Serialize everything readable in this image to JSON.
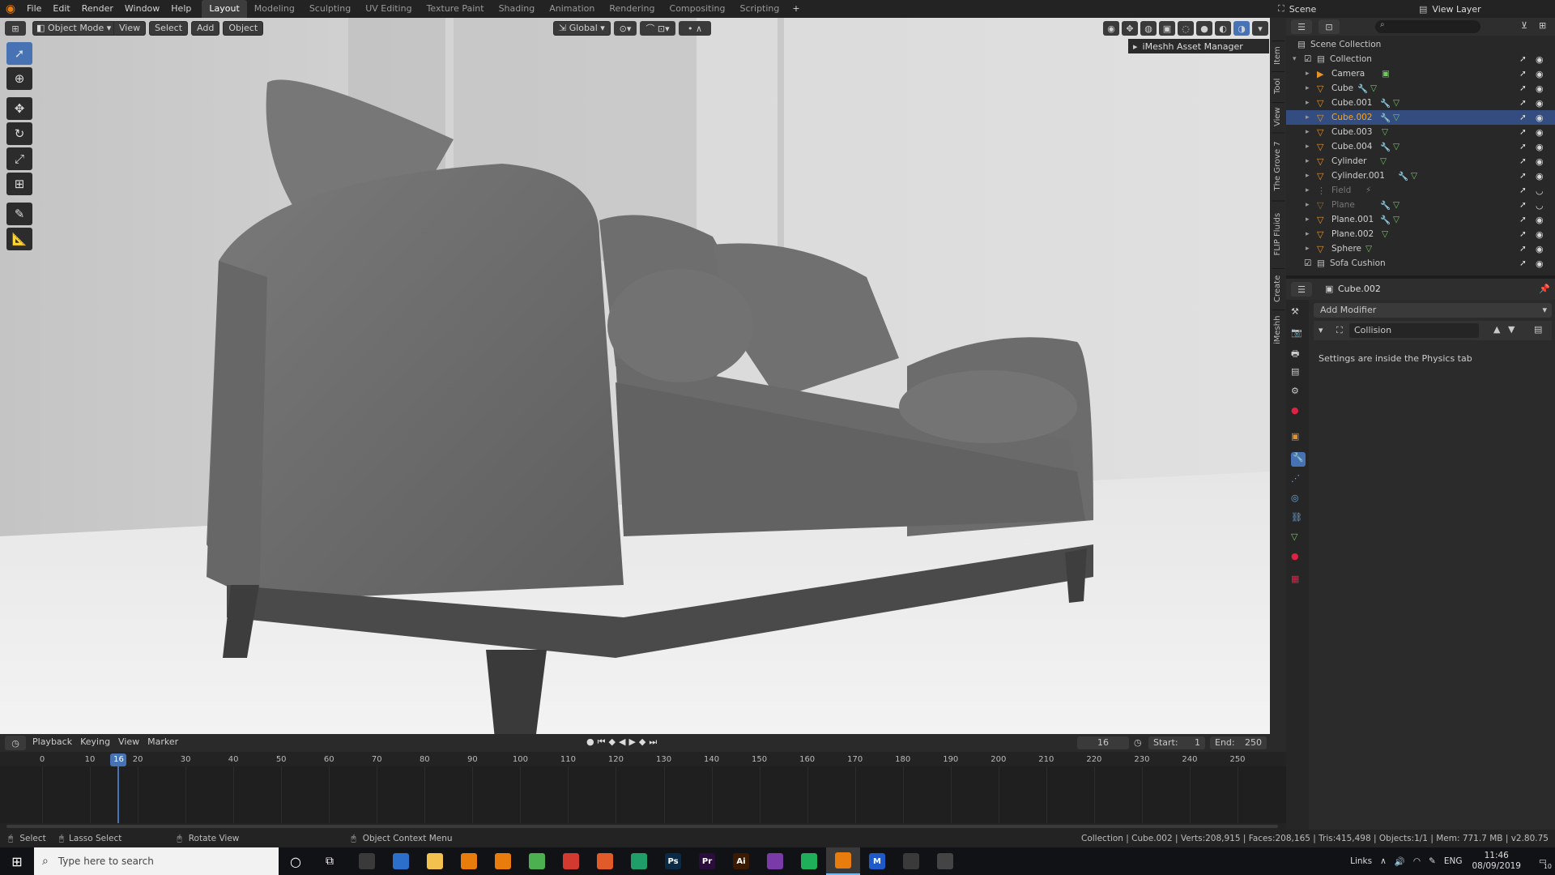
{
  "topbar": {
    "menus": [
      "File",
      "Edit",
      "Render",
      "Window",
      "Help"
    ],
    "workspaces": [
      "Layout",
      "Modeling",
      "Sculpting",
      "UV Editing",
      "Texture Paint",
      "Shading",
      "Animation",
      "Rendering",
      "Compositing",
      "Scripting"
    ],
    "active_workspace": "Layout",
    "scene_label": "Scene",
    "view_layer_label": "View Layer"
  },
  "viewport_header": {
    "mode": "Object Mode",
    "menus": [
      "View",
      "Select",
      "Add",
      "Object"
    ],
    "transform_orientation": "Global",
    "addon_panel": "iMeshh Asset Manager",
    "side_tabs": [
      "Item",
      "Tool",
      "View",
      "The Grove 7",
      "FLIP Fluids",
      "Create",
      "iMeshh"
    ]
  },
  "outliner": {
    "root": "Scene Collection",
    "collection": "Collection",
    "items": [
      {
        "name": "Camera",
        "type": "camera",
        "dimmed": false,
        "selected": false
      },
      {
        "name": "Cube",
        "type": "mesh",
        "dimmed": false,
        "selected": false
      },
      {
        "name": "Cube.001",
        "type": "mesh",
        "dimmed": false,
        "selected": false
      },
      {
        "name": "Cube.002",
        "type": "mesh",
        "dimmed": false,
        "selected": true
      },
      {
        "name": "Cube.003",
        "type": "mesh",
        "dimmed": false,
        "selected": false
      },
      {
        "name": "Cube.004",
        "type": "mesh",
        "dimmed": false,
        "selected": false
      },
      {
        "name": "Cylinder",
        "type": "mesh",
        "dimmed": false,
        "selected": false
      },
      {
        "name": "Cylinder.001",
        "type": "mesh",
        "dimmed": false,
        "selected": false
      },
      {
        "name": "Field",
        "type": "field",
        "dimmed": true,
        "selected": false
      },
      {
        "name": "Plane",
        "type": "mesh",
        "dimmed": true,
        "selected": false
      },
      {
        "name": "Plane.001",
        "type": "mesh",
        "dimmed": false,
        "selected": false
      },
      {
        "name": "Plane.002",
        "type": "mesh",
        "dimmed": false,
        "selected": false
      },
      {
        "name": "Sphere",
        "type": "mesh",
        "dimmed": false,
        "selected": false
      }
    ],
    "sub_collection": "Sofa Cushion"
  },
  "properties": {
    "object_name": "Cube.002",
    "add_modifier": "Add Modifier",
    "modifier_name": "Collision",
    "info_text": "Settings are inside the Physics tab"
  },
  "timeline": {
    "menus": [
      "Playback",
      "Keying",
      "View",
      "Marker"
    ],
    "current_frame": "16",
    "start_label": "Start:",
    "start_value": "1",
    "end_label": "End:",
    "end_value": "250",
    "ticks": [
      "0",
      "10",
      "20",
      "30",
      "40",
      "50",
      "60",
      "70",
      "80",
      "90",
      "100",
      "110",
      "120",
      "130",
      "140",
      "150",
      "160",
      "170",
      "180",
      "190",
      "200",
      "210",
      "220",
      "230",
      "240",
      "250"
    ]
  },
  "statusbar": {
    "select": "Select",
    "lasso": "Lasso Select",
    "rotate": "Rotate View",
    "context": "Object Context Menu",
    "stats": "Collection | Cube.002 | Verts:208,915 | Faces:208,165 | Tris:415,498 | Objects:1/1 | Mem: 771.7 MB | v2.80.75"
  },
  "taskbar": {
    "search_placeholder": "Type here to search",
    "links": "Links",
    "language": "ENG",
    "time": "11:46",
    "date": "08/09/2019",
    "notification_count": "10",
    "apps": [
      {
        "name": "calculator",
        "label": "",
        "color": "#3a3a3a"
      },
      {
        "name": "edge",
        "label": "",
        "color": "#2a6fc9"
      },
      {
        "name": "file-explorer",
        "label": "",
        "color": "#f2c14e"
      },
      {
        "name": "blender-a",
        "label": "",
        "color": "#e87d0d"
      },
      {
        "name": "blender-b",
        "label": "",
        "color": "#e87d0d"
      },
      {
        "name": "chrome",
        "label": "",
        "color": "#4caf50"
      },
      {
        "name": "app-red",
        "label": "",
        "color": "#d23a2f"
      },
      {
        "name": "app-orange",
        "label": "",
        "color": "#e05a2a"
      },
      {
        "name": "play",
        "label": "",
        "color": "#1f9e6a"
      },
      {
        "name": "photoshop",
        "label": "Ps",
        "color": "#0b2a45"
      },
      {
        "name": "premiere",
        "label": "Pr",
        "color": "#2a0d3a"
      },
      {
        "name": "illustrator",
        "label": "Ai",
        "color": "#3a1a00"
      },
      {
        "name": "photos",
        "label": "",
        "color": "#7a3aa8"
      },
      {
        "name": "app-green",
        "label": "",
        "color": "#1fae5a"
      },
      {
        "name": "blender-active",
        "label": "",
        "color": "#e87d0d"
      },
      {
        "name": "app-blue",
        "label": "M",
        "color": "#1e5ac8"
      },
      {
        "name": "image-viewer",
        "label": "",
        "color": "#3a3a3a"
      },
      {
        "name": "app-circle",
        "label": "",
        "color": "#444444"
      }
    ]
  },
  "colors": {
    "accent": "#4772b3",
    "selected_orange": "#f5a623",
    "mesh_orange": "#e8932a",
    "mesh_green": "#6fcc5b"
  }
}
